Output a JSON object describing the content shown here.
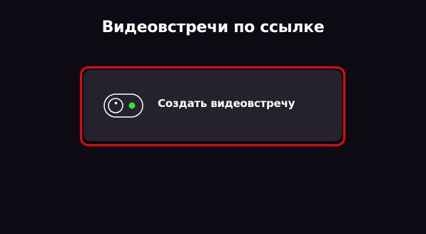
{
  "page": {
    "title": "Видеовстречи по ссылке"
  },
  "create_meeting": {
    "label": "Создать видеовстречу",
    "icon": "camera-toggle-icon"
  },
  "colors": {
    "background": "#0d0a14",
    "card": "#25222e",
    "highlight": "#e30b0b",
    "indicator": "#2ee82e"
  }
}
